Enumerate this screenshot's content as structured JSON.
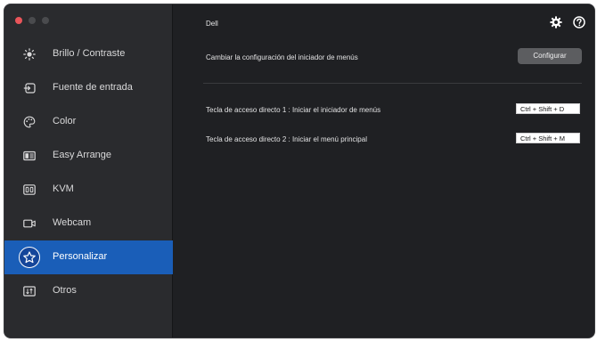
{
  "header": {
    "title": "Dell"
  },
  "sidebar": {
    "items": [
      {
        "label": "Brillo / Contraste",
        "icon": "brightness-icon"
      },
      {
        "label": "Fuente de entrada",
        "icon": "input-source-icon"
      },
      {
        "label": "Color",
        "icon": "palette-icon"
      },
      {
        "label": "Easy Arrange",
        "icon": "layout-icon"
      },
      {
        "label": "KVM",
        "icon": "kvm-icon"
      },
      {
        "label": "Webcam",
        "icon": "webcam-icon"
      },
      {
        "label": "Personalizar",
        "icon": "star-icon",
        "active": true
      },
      {
        "label": "Otros",
        "icon": "others-icon"
      }
    ]
  },
  "main": {
    "menu_launcher_label": "Cambiar la configuración del iniciador de menús",
    "configure_button": "Configurar",
    "hotkey1_label": "Tecla de acceso directo 1 : Iniciar el iniciador de menús",
    "hotkey1_value": "Ctrl + Shift + D",
    "hotkey2_label": "Tecla de acceso directo 2 : Iniciar el menú principal",
    "hotkey2_value": "Ctrl + Shift + M"
  },
  "colors": {
    "accent": "#1a5eb8",
    "sidebar_bg": "#2a2b2e",
    "main_bg": "#1f2023",
    "button_bg": "#5c5d60"
  }
}
